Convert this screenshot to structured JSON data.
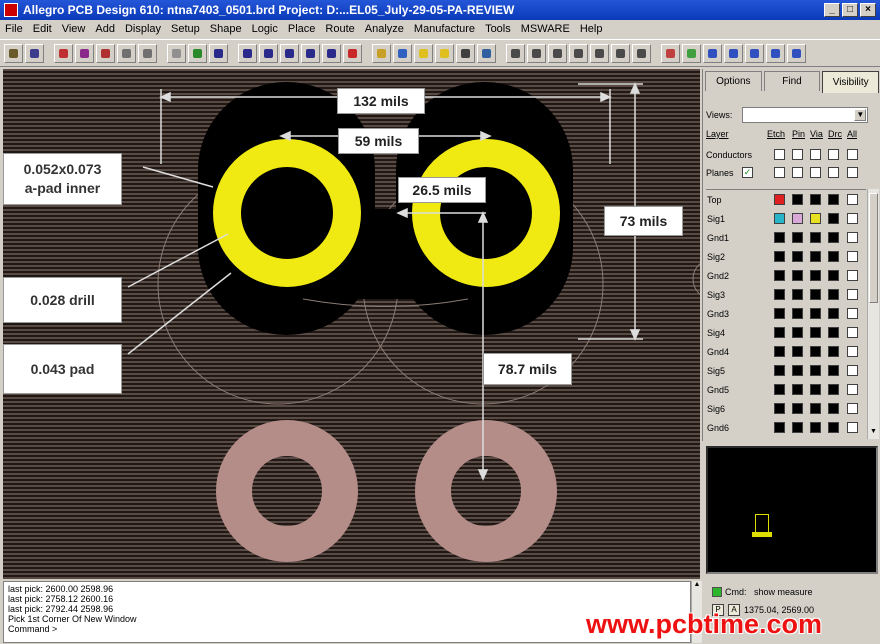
{
  "window": {
    "title": "Allegro PCB Design 610: ntna7403_0501.brd  Project: D:...EL05_July-29-05-PA-REVIEW",
    "minimize_label": "_",
    "maximize_label": "□",
    "close_label": "×"
  },
  "menu": [
    "File",
    "Edit",
    "View",
    "Add",
    "Display",
    "Setup",
    "Shape",
    "Logic",
    "Place",
    "Route",
    "Analyze",
    "Manufacture",
    "Tools",
    "MSWARE",
    "Help"
  ],
  "colors": {
    "pad_inner": "#f0ea12",
    "pad_outer": "#b48c88",
    "antipad": "#000000",
    "background_stripe": "#5a4a44",
    "watermark": "#ee1111"
  },
  "canvas": {
    "dimensions": {
      "width_132": "132 mils",
      "spacing_59": "59 mils",
      "inner_26_5": "26.5 mils",
      "height_73": "73 mils",
      "pitch_78_7": "78.7 mils"
    },
    "callouts": {
      "apad_line1": "0.052x0.073",
      "apad_line2": "a-pad inner",
      "drill": "0.028 drill",
      "pad": "0.043 pad"
    }
  },
  "panel": {
    "tabs": [
      "Options",
      "Find",
      "Visibility"
    ],
    "active_tab": "Visibility",
    "views_label": "Views:",
    "views_value": "",
    "columns": {
      "layer": "Layer",
      "etch": "Etch",
      "pin": "Pin",
      "via": "Via",
      "drc": "Drc",
      "all": "All"
    },
    "groups": [
      {
        "name": "Conductors",
        "all_checked": false
      },
      {
        "name": "Planes",
        "checked": true
      }
    ],
    "layers": [
      {
        "name": "Top",
        "swatches": [
          "#e02020",
          "#000",
          "#000",
          "#000"
        ]
      },
      {
        "name": "Sig1",
        "swatches": [
          "#28b4c8",
          "#d8a8d8",
          "#e8e020",
          "#000"
        ]
      },
      {
        "name": "Gnd1",
        "swatches": [
          "#000",
          "#000",
          "#000",
          "#000"
        ]
      },
      {
        "name": "Sig2",
        "swatches": [
          "#000",
          "#000",
          "#000",
          "#000"
        ]
      },
      {
        "name": "Gnd2",
        "swatches": [
          "#000",
          "#000",
          "#000",
          "#000"
        ]
      },
      {
        "name": "Sig3",
        "swatches": [
          "#000",
          "#000",
          "#000",
          "#000"
        ]
      },
      {
        "name": "Gnd3",
        "swatches": [
          "#000",
          "#000",
          "#000",
          "#000"
        ]
      },
      {
        "name": "Sig4",
        "swatches": [
          "#000",
          "#000",
          "#000",
          "#000"
        ]
      },
      {
        "name": "Gnd4",
        "swatches": [
          "#000",
          "#000",
          "#000",
          "#000"
        ]
      },
      {
        "name": "Sig5",
        "swatches": [
          "#000",
          "#000",
          "#000",
          "#000"
        ]
      },
      {
        "name": "Gnd5",
        "swatches": [
          "#000",
          "#000",
          "#000",
          "#000"
        ]
      },
      {
        "name": "Sig6",
        "swatches": [
          "#000",
          "#000",
          "#000",
          "#000"
        ]
      },
      {
        "name": "Gnd6",
        "swatches": [
          "#000",
          "#000",
          "#000",
          "#000"
        ]
      }
    ]
  },
  "command_window": {
    "lines": [
      "last pick:  2600.00  2598.96",
      "last pick:  2758.12  2600.16",
      "last pick:  2792.44  2598.96",
      "Pick 1st Corner Of New Window",
      "Command >"
    ]
  },
  "status": {
    "cmd_label": "Cmd:",
    "cmd_text": "show measure",
    "p_label": "P",
    "a_label": "A",
    "coords": "1375.04, 2569.00"
  },
  "watermark": "www.pcbtime.com"
}
